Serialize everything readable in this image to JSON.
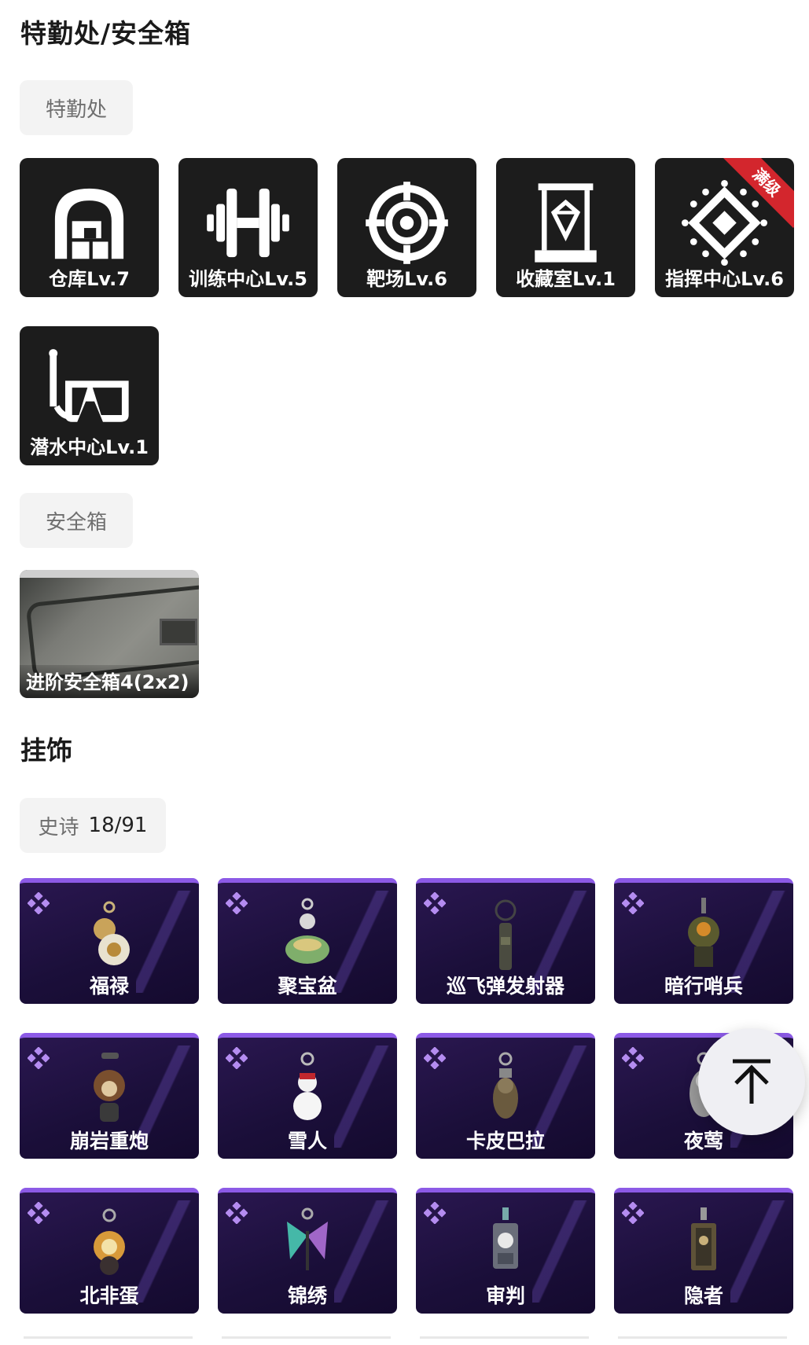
{
  "sections": {
    "office_title": "特勤处/安全箱",
    "office_tab": "特勤处",
    "safebox_tab": "安全箱",
    "charms_title": "挂饰"
  },
  "buildings": [
    {
      "label": "仓库Lv.7",
      "icon": "warehouse-icon"
    },
    {
      "label": "训练中心Lv.5",
      "icon": "dumbbell-icon"
    },
    {
      "label": "靶场Lv.6",
      "icon": "target-icon"
    },
    {
      "label": "收藏室Lv.1",
      "icon": "display-case-icon"
    },
    {
      "label": "指挥中心Lv.6",
      "icon": "chip-icon",
      "badge": "满级"
    },
    {
      "label": "潜水中心Lv.1",
      "icon": "diving-mask-icon"
    }
  ],
  "safebox": {
    "label": "进阶安全箱4(2x2)"
  },
  "charm_filter": {
    "rarity": "史诗",
    "count": "18/91"
  },
  "charms": [
    {
      "label": "福禄"
    },
    {
      "label": "聚宝盆"
    },
    {
      "label": "巡飞弹发射器"
    },
    {
      "label": "暗行哨兵"
    },
    {
      "label": "崩岩重炮"
    },
    {
      "label": "雪人"
    },
    {
      "label": "卡皮巴拉"
    },
    {
      "label": "夜莺"
    },
    {
      "label": "北非蛋"
    },
    {
      "label": "锦绣"
    },
    {
      "label": "审判"
    },
    {
      "label": "隐者"
    }
  ],
  "colors": {
    "epic_accent": "#8c5ae6",
    "max_badge": "#d3262d",
    "tile_bg": "#1c1c1c"
  },
  "back_to_top_icon": "arrow-up-icon"
}
